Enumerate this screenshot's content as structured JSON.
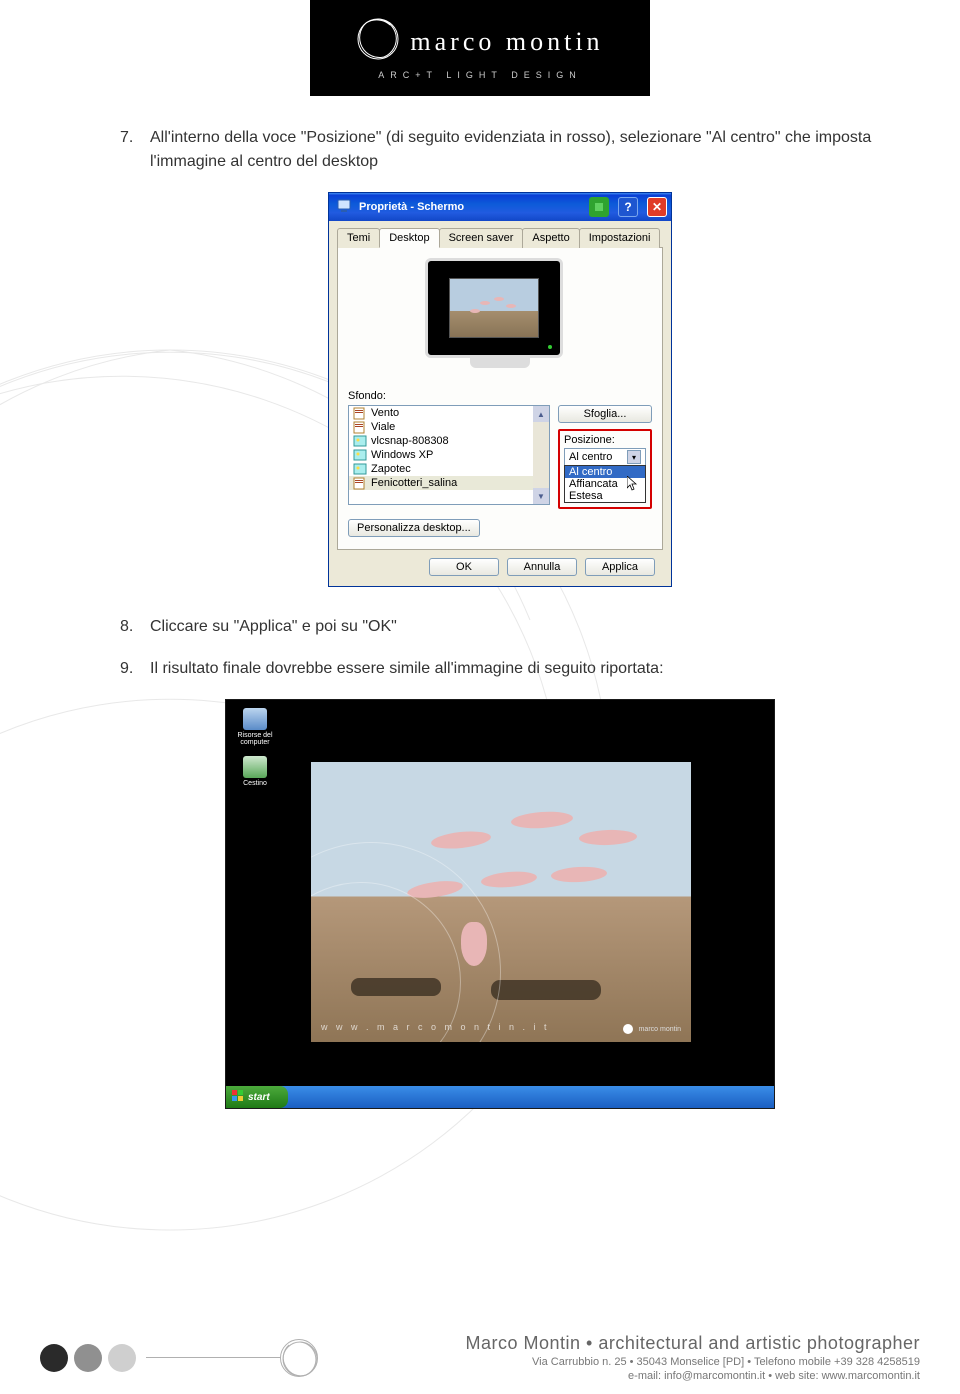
{
  "logo": {
    "name": "marco montin",
    "sub": "ARC+T  LIGHT  DESIGN"
  },
  "steps": {
    "s7": {
      "num": "7.",
      "text": "All'interno della voce \"Posizione\" (di seguito evidenziata in rosso), selezionare \"Al centro\" che imposta l'immagine al centro del desktop"
    },
    "s8": {
      "num": "8.",
      "text": "Cliccare su \"Applica\" e poi su \"OK\""
    },
    "s9": {
      "num": "9.",
      "text": "Il risultato finale dovrebbe essere simile all'immagine di seguito riportata:"
    }
  },
  "dialog": {
    "title": "Proprietà - Schermo",
    "tabs": [
      "Temi",
      "Desktop",
      "Screen saver",
      "Aspetto",
      "Impostazioni"
    ],
    "active_tab": 1,
    "sfondo_label": "Sfondo:",
    "bg_items": [
      "Vento",
      "Viale",
      "vlcsnap-808308",
      "Windows XP",
      "Zapotec",
      "Fenicotteri_salina"
    ],
    "bg_selected_index": 5,
    "browse": "Sfoglia...",
    "pos_label": "Posizione:",
    "pos_value": "Al centro",
    "pos_options": [
      "Al centro",
      "Affiancata",
      "Estesa"
    ],
    "personalize": "Personalizza desktop...",
    "ok": "OK",
    "cancel": "Annulla",
    "apply": "Applica"
  },
  "desktop": {
    "icons": [
      {
        "label": "Risorse del computer"
      },
      {
        "label": "Cestino"
      }
    ],
    "watermark": "w w w . m a r c o m o n t i n . i t",
    "brand": "marco montin",
    "start": "start"
  },
  "footer": {
    "main": "Marco Montin • architectural and artistic photographer",
    "line1": "Via Carrubbio n. 25 • 35043 Monselice [PD] • Telefono mobile +39 328 4258519",
    "line2": "e-mail: info@marcomontin.it • web site: www.marcomontin.it"
  }
}
